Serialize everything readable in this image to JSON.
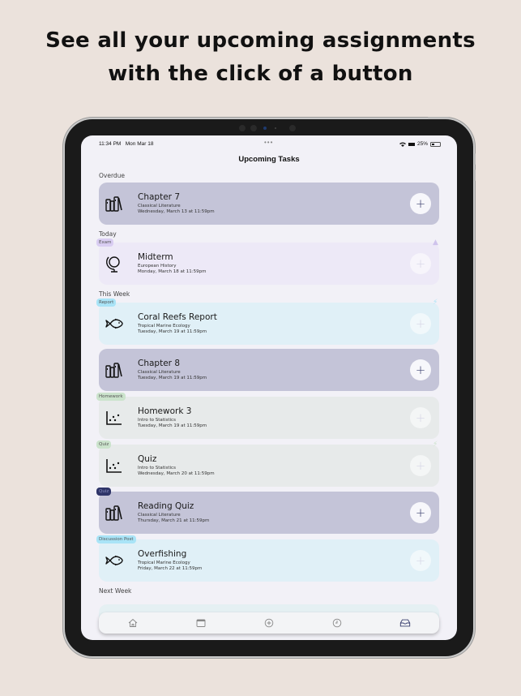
{
  "headline": {
    "line1": "See all your upcoming assignments",
    "line2": "with the click of a button"
  },
  "status_bar": {
    "time": "11:34 PM",
    "date": "Mon Mar 18",
    "dots": "•••",
    "battery": "25%"
  },
  "nav": {
    "title": "Upcoming Tasks"
  },
  "sections": {
    "overdue": "Overdue",
    "today": "Today",
    "this_week": "This Week",
    "next_week": "Next Week"
  },
  "tasks": [
    {
      "title": "Chapter 7",
      "course": "Classical Literature",
      "due": "Wednesday, March 13 at 11:59pm",
      "tag": "",
      "icon": "books-icon",
      "color": "#c4c4d8"
    },
    {
      "title": "Midterm",
      "course": "European History",
      "due": "Monday, March 18 at 11:59pm",
      "tag": "Exam",
      "icon": "globe-icon",
      "color": "#ede9f7",
      "flag": "warning-icon"
    },
    {
      "title": "Coral Reefs Report",
      "course": "Tropical Marine Ecology",
      "due": "Tuesday, March 19 at 11:59pm",
      "tag": "Report",
      "icon": "fish-icon",
      "color": "#e0f0f7",
      "flag": "lightning-icon"
    },
    {
      "title": "Chapter 8",
      "course": "Classical Literature",
      "due": "Tuesday, March 19 at 11:59pm",
      "tag": "",
      "icon": "books-icon",
      "color": "#c4c4d8"
    },
    {
      "title": "Homework 3",
      "course": "Intro to Statistics",
      "due": "Tuesday, March 19 at 11:59pm",
      "tag": "Homework",
      "icon": "scatter-plot-icon",
      "color": "#e7eaea"
    },
    {
      "title": "Quiz",
      "course": "Intro to Statistics",
      "due": "Wednesday, March 20 at 11:59pm",
      "tag": "Quiz",
      "icon": "scatter-plot-icon",
      "color": "#e7eaea",
      "flag": "lightning-icon"
    },
    {
      "title": "Reading Quiz",
      "course": "Classical Literature",
      "due": "Thursday, March 21 at 11:59pm",
      "tag": "Quiz",
      "icon": "books-icon",
      "color": "#c4c4d8"
    },
    {
      "title": "Overfishing",
      "course": "Tropical Marine Ecology",
      "due": "Friday, March 22 at 11:59pm",
      "tag": "Discussion Post",
      "icon": "fish-icon",
      "color": "#e0f0f7"
    }
  ],
  "add_button_label": "+",
  "tab_bar": {
    "items": [
      "home-icon",
      "calendar-icon",
      "add-circle-icon",
      "clock-icon",
      "inbox-icon"
    ],
    "active": "inbox-icon"
  }
}
